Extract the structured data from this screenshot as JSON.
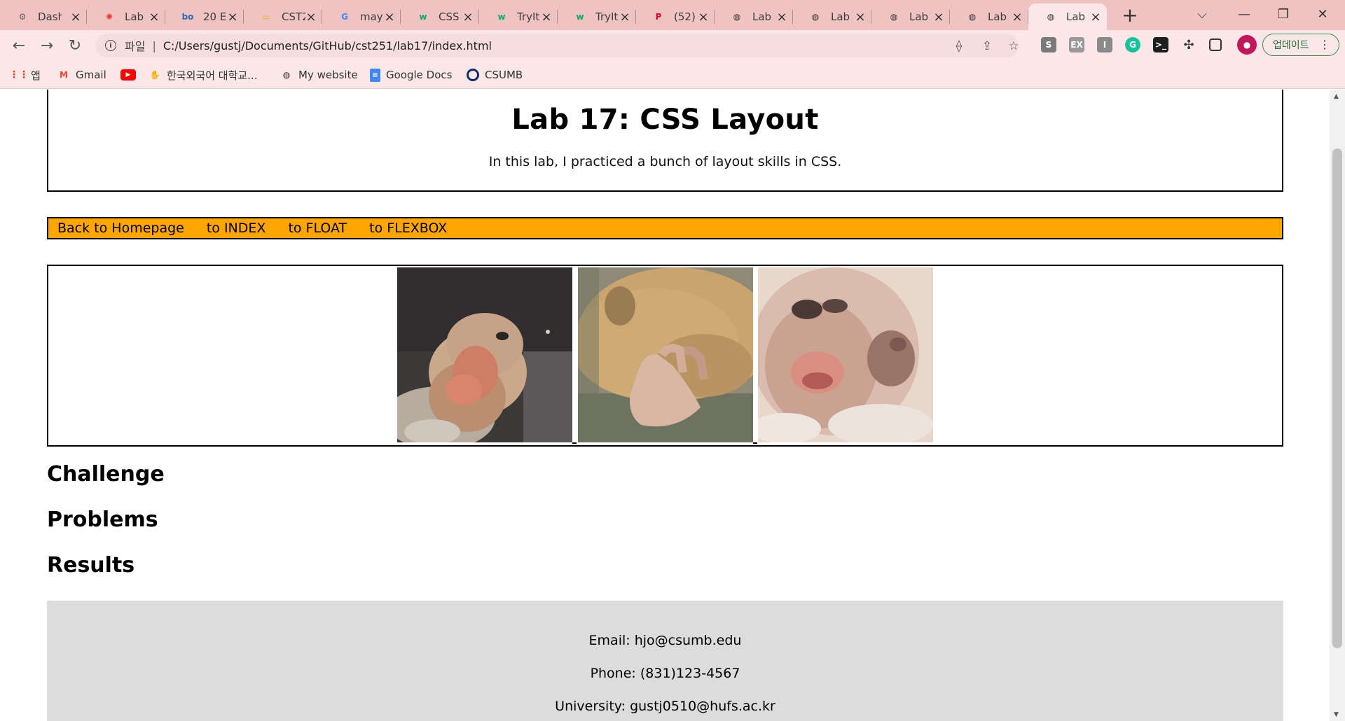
{
  "browser": {
    "tabs": [
      {
        "title": "Dash",
        "favicon": "dashboard-icon",
        "fav_color": "#5f6368",
        "fav_text": "⚙"
      },
      {
        "title": "Lab",
        "favicon": "canvas-icon",
        "fav_color": "#e03c31",
        "fav_text": "✺"
      },
      {
        "title": "20 E",
        "favicon": "bo-icon",
        "fav_color": "#2b6cb0",
        "fav_text": "bo"
      },
      {
        "title": "CST2",
        "favicon": "slides-icon",
        "fav_color": "#f4b400",
        "fav_text": "▭"
      },
      {
        "title": "may",
        "favicon": "google-icon",
        "fav_color": "#4285f4",
        "fav_text": "G"
      },
      {
        "title": "CSS",
        "favicon": "w3schools-icon",
        "fav_color": "#04aa6d",
        "fav_text": "w"
      },
      {
        "title": "TryIt",
        "favicon": "w3schools-icon",
        "fav_color": "#04aa6d",
        "fav_text": "w"
      },
      {
        "title": "TryIt",
        "favicon": "w3schools-icon",
        "fav_color": "#04aa6d",
        "fav_text": "w"
      },
      {
        "title": "(52)",
        "favicon": "pinterest-icon",
        "fav_color": "#e60023",
        "fav_text": "P"
      },
      {
        "title": "Lab",
        "favicon": "globe-icon",
        "fav_color": "#333333",
        "fav_text": "◍"
      },
      {
        "title": "Lab",
        "favicon": "globe-icon",
        "fav_color": "#333333",
        "fav_text": "◍"
      },
      {
        "title": "Lab",
        "favicon": "globe-icon",
        "fav_color": "#333333",
        "fav_text": "◍"
      },
      {
        "title": "Lab",
        "favicon": "globe-icon",
        "fav_color": "#333333",
        "fav_text": "◍"
      },
      {
        "title": "Lab",
        "favicon": "globe-icon",
        "fav_color": "#333333",
        "fav_text": "◍",
        "active": true
      }
    ],
    "address": {
      "scheme_label": "파일",
      "url": "C:/Users/gustj/Documents/GitHub/cst251/lab17/index.html"
    },
    "update_label": "업데이트",
    "bookmarks": [
      {
        "label": "앱",
        "icon": "apps-grid-icon"
      },
      {
        "label": "Gmail",
        "icon": "gmail-icon"
      },
      {
        "label": "",
        "icon": "youtube-icon"
      },
      {
        "label": "한국외국어 대학교...",
        "icon": "hufs-icon"
      },
      {
        "label": "My website",
        "icon": "globe-icon"
      },
      {
        "label": "Google Docs",
        "icon": "docs-icon"
      },
      {
        "label": "CSUMB",
        "icon": "csumb-icon"
      }
    ],
    "colors": {
      "frame": "#f0c3c3",
      "toolbar": "#fbe7e7"
    }
  },
  "page": {
    "title": "Lab 17: CSS Layout",
    "intro": "In this lab, I practiced a bunch of layout skills in CSS.",
    "nav": [
      "Back to Homepage",
      "to INDEX",
      "to FLOAT",
      "to FLEXBOX"
    ],
    "nav_color": "#ffa500",
    "gallery": [
      {
        "subject": "duck-photo"
      },
      {
        "subject": "hamster-photo"
      },
      {
        "subject": "monkey-photo"
      }
    ],
    "sections": [
      "Challenge",
      "Problems",
      "Results"
    ],
    "footer": {
      "email": "Email: hjo@csumb.edu",
      "phone": "Phone: (831)123-4567",
      "university": "University: gustj0510@hufs.ac.kr"
    },
    "footer_color": "#dcdcdc"
  }
}
